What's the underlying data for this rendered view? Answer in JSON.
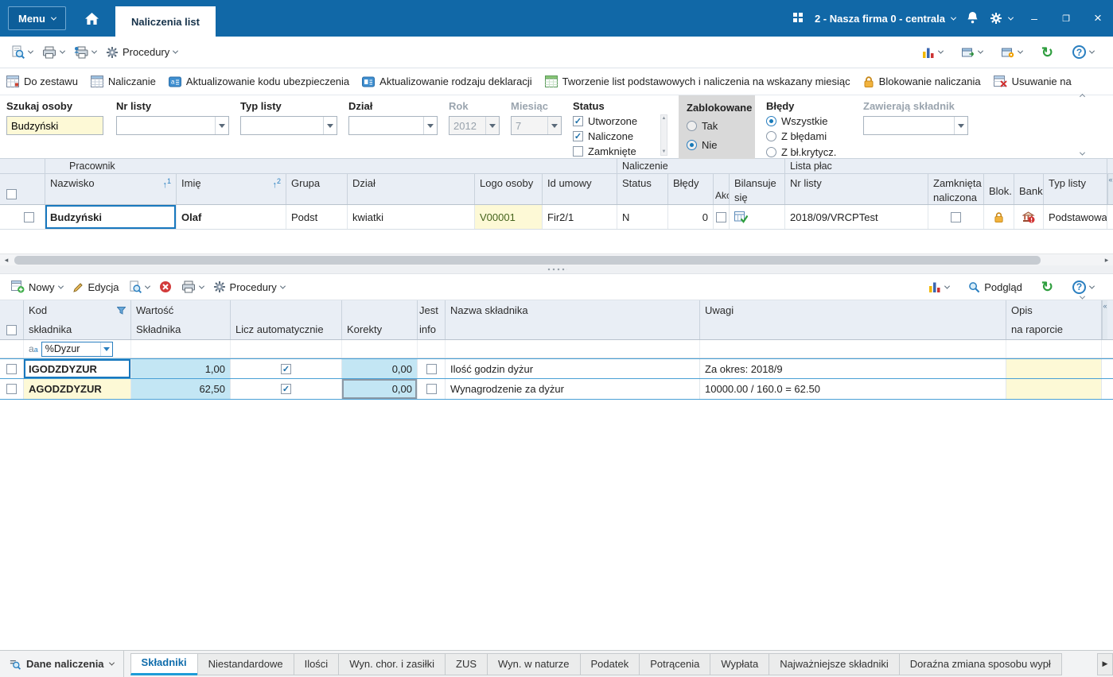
{
  "topbar": {
    "menu": "Menu",
    "tab": "Naliczenia list",
    "company": "2 - Nasza firma 0 - centrala"
  },
  "toolbar_main": {
    "procedury": "Procedury",
    "actions": [
      "Do zestawu",
      "Naliczanie",
      "Aktualizowanie kodu ubezpieczenia",
      "Aktualizowanie rodzaju deklaracji",
      "Tworzenie list podstawowych i naliczenia na wskazany miesiąc",
      "Blokowanie naliczania",
      "Usuwanie na"
    ]
  },
  "filters": {
    "szukaj_label": "Szukaj osoby",
    "szukaj_value": "Budzyński",
    "nr_listy_label": "Nr listy",
    "typ_listy_label": "Typ listy",
    "dzial_label": "Dział",
    "rok_label": "Rok",
    "rok_value": "2012",
    "miesiac_label": "Miesiąc",
    "miesiac_value": "7",
    "status_label": "Status",
    "status_options": [
      {
        "label": "Utworzone",
        "checked": true
      },
      {
        "label": "Naliczone",
        "checked": true
      },
      {
        "label": "Zamknięte",
        "checked": false
      }
    ],
    "zablokowane_label": "Zablokowane",
    "zablokowane_options": [
      {
        "label": "Tak",
        "selected": false
      },
      {
        "label": "Nie",
        "selected": true
      }
    ],
    "bledy_label": "Błędy",
    "bledy_options": [
      {
        "label": "Wszystkie",
        "selected": true
      },
      {
        "label": "Z błędami",
        "selected": false
      },
      {
        "label": "Z bł.krytycz.",
        "selected": false
      }
    ],
    "zawieraja_label": "Zawierają składnik"
  },
  "grid": {
    "groups": {
      "pracownik": "Pracownik",
      "naliczenie": "Naliczenie",
      "lista_plac": "Lista płac"
    },
    "headers": {
      "nazwisko": "Nazwisko",
      "nazwisko_sortnum": "1",
      "imie": "Imię",
      "imie_sortnum": "2",
      "grupa": "Grupa",
      "dzial": "Dział",
      "logo": "Logo osoby",
      "id_umowy": "Id umowy",
      "status": "Status",
      "bledy": "Błędy",
      "akc": "Akc",
      "bilansuje1": "Bilansuje",
      "bilansuje2": "się",
      "nr_listy": "Nr listy",
      "zamknieta1": "Zamknięta",
      "zamknieta2": "naliczona",
      "blok": "Blok.",
      "bank": "Bank",
      "typ_listy": "Typ listy"
    },
    "row": {
      "nazwisko": "Budzyński",
      "imie": "Olaf",
      "grupa": "Podst",
      "dzial": "kwiatki",
      "logo": "V00001",
      "id_umowy": "Fir2/1",
      "status": "N",
      "bledy": "0",
      "akc": false,
      "nr_listy": "2018/09/VRCPTest",
      "zamknieta": false,
      "typ_listy": "Podstawowa"
    }
  },
  "detail_toolbar": {
    "nowy": "Nowy",
    "edycja": "Edycja",
    "procedury": "Procedury",
    "podglad": "Podgląd"
  },
  "detail_grid": {
    "headers": {
      "kod1": "Kod",
      "kod2": "składnika",
      "wartosc1": "Wartość",
      "wartosc2": "Składnika",
      "licz": "Licz automatycznie",
      "korekty": "Korekty",
      "jest1": "Jest",
      "jest2": "info",
      "nazwa": "Nazwa składnika",
      "uwagi": "Uwagi",
      "opis1": "Opis",
      "opis2": "na raporcie"
    },
    "filter_value": "%Dyzur",
    "rows": [
      {
        "kod": "IGODZDYZUR",
        "wartosc": "1,00",
        "licz": true,
        "korekty": "0,00",
        "jest_info": false,
        "nazwa": "Ilość godzin dyżur",
        "uwagi": "Za okres: 2018/9"
      },
      {
        "kod": "AGODZDYZUR",
        "wartosc": "62,50",
        "licz": true,
        "korekty": "0,00",
        "jest_info": false,
        "nazwa": "Wynagrodzenie za dyżur",
        "uwagi": "10000.00 / 160.0 = 62.50"
      }
    ]
  },
  "bottom": {
    "selector": "Dane naliczenia",
    "tabs": [
      "Składniki",
      "Niestandardowe",
      "Ilości",
      "Wyn. chor. i zasiłki",
      "ZUS",
      "Wyn. w naturze",
      "Podatek",
      "Potrącenia",
      "Wypłata",
      "Najważniejsze składniki",
      "Doraźna zmiana sposobu wypł"
    ]
  }
}
